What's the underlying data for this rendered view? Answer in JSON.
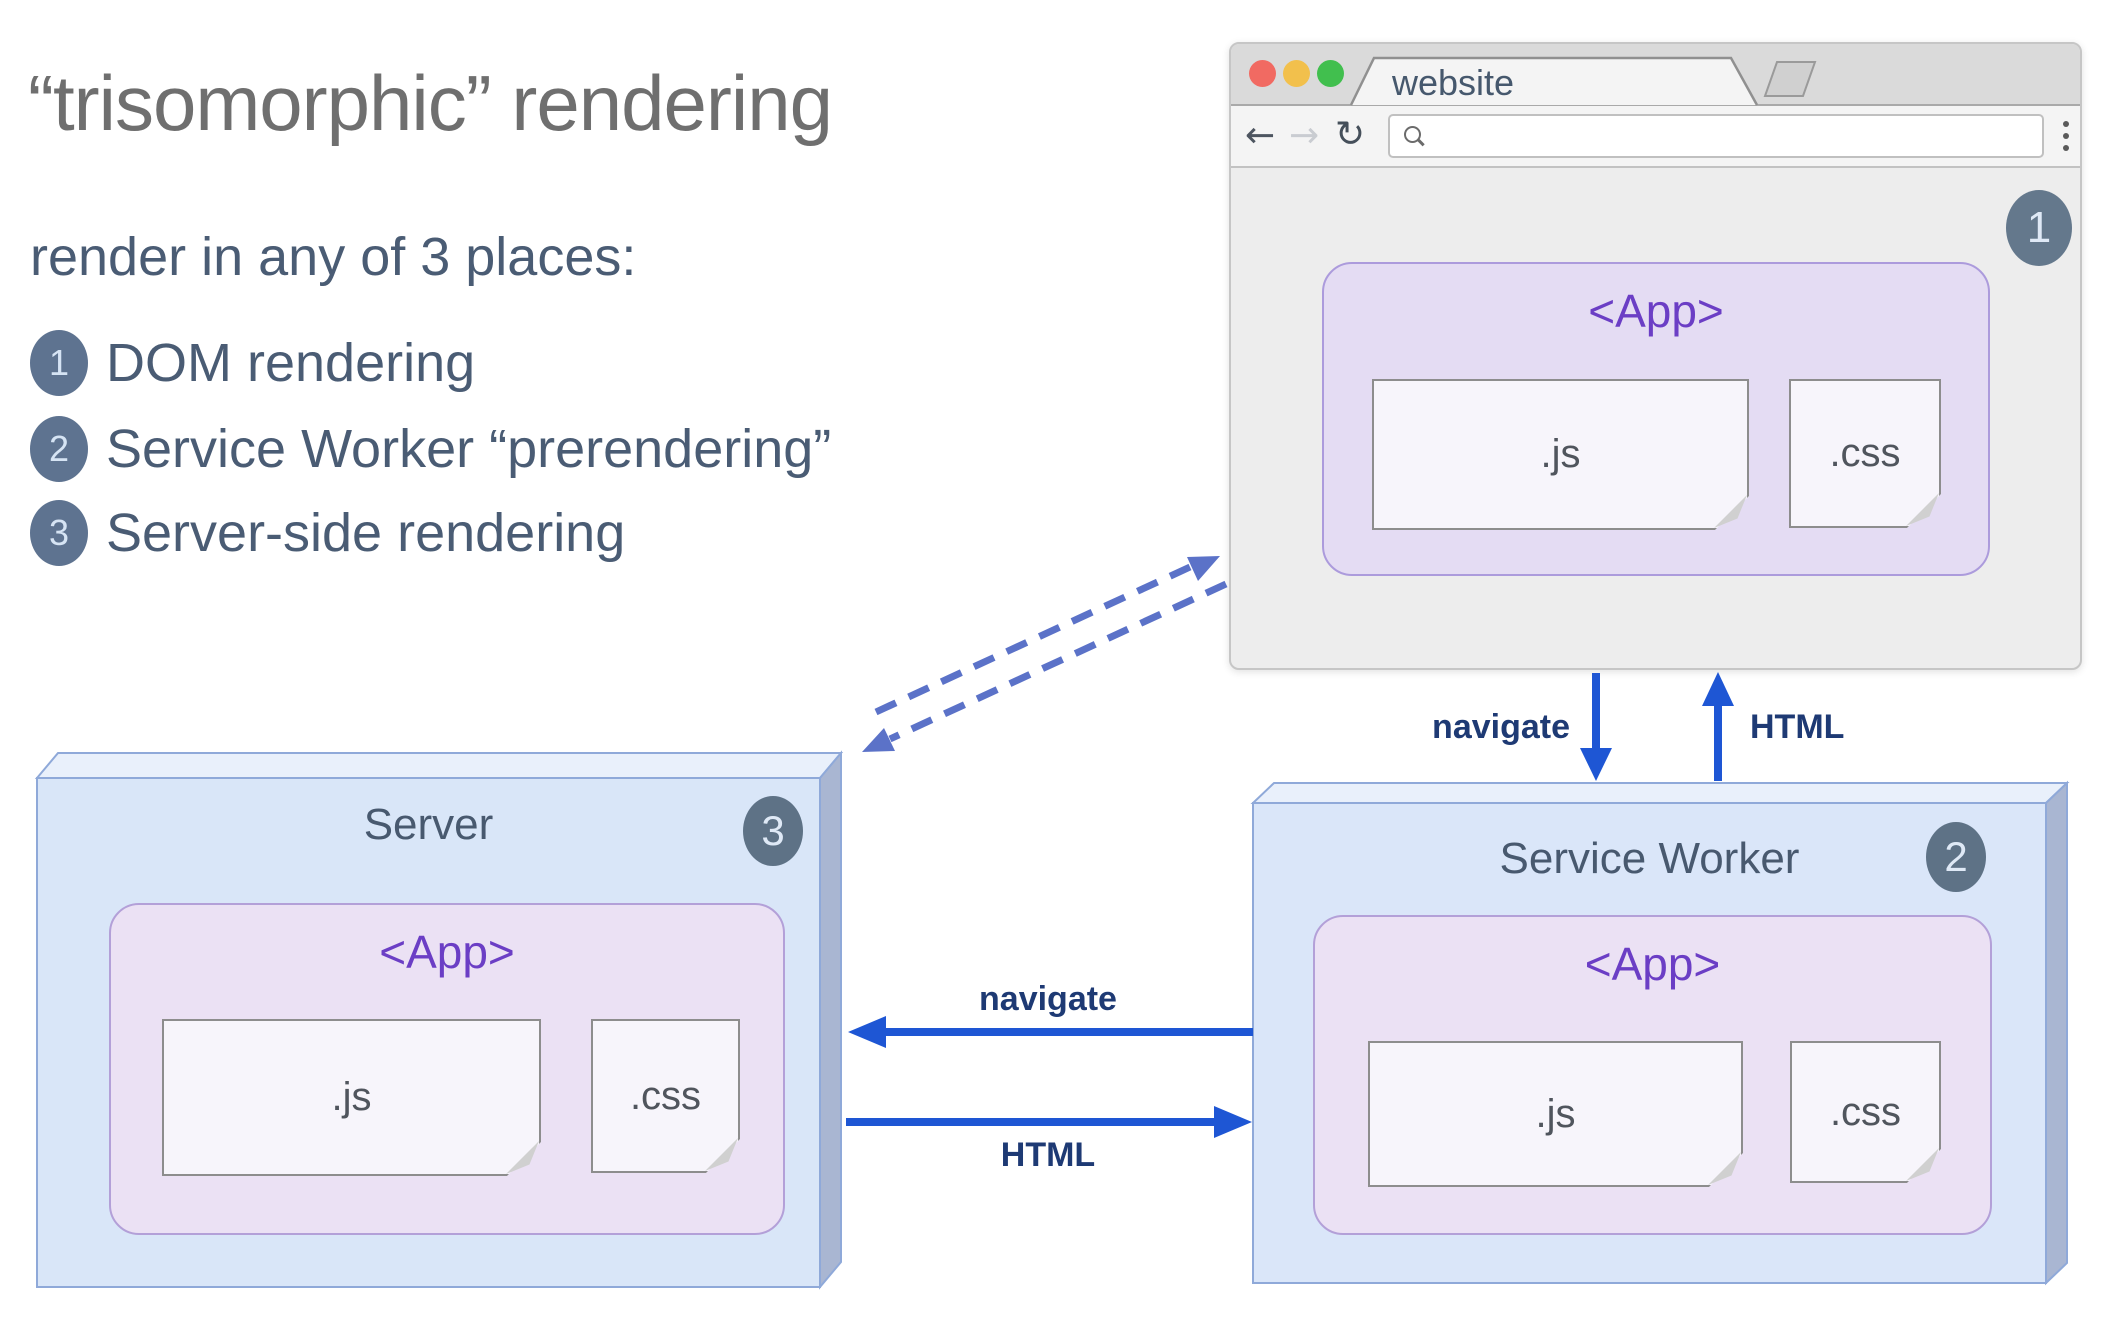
{
  "colors": {
    "accent_blue": "#1e56d4",
    "dashed_blue": "#5b72c8",
    "badge_slate": "#5e7390",
    "text_slate": "#4a5c74",
    "title_gray": "#6f6f6f",
    "app_purple": "#6b3ec5",
    "box_blue_front": "#d9e6f8",
    "traffic_red": "#f16a62",
    "traffic_yellow": "#f2c04c",
    "traffic_green": "#41bf4e"
  },
  "left_panel": {
    "title": "“trisomorphic” rendering",
    "subtitle": "render in any of 3 places:",
    "items": [
      {
        "num": "1",
        "label": "DOM rendering"
      },
      {
        "num": "2",
        "label": "Service Worker “prerendering”"
      },
      {
        "num": "3",
        "label": "Server-side rendering"
      }
    ]
  },
  "browser": {
    "tab_title": "website",
    "url_value": "",
    "badge": "1",
    "back_icon": "←",
    "forward_icon": "→",
    "reload_icon": "↻",
    "app": {
      "label": "<App>",
      "js": ".js",
      "css": ".css"
    }
  },
  "server_box": {
    "title": "Server",
    "badge": "3",
    "app": {
      "label": "<App>",
      "js": ".js",
      "css": ".css"
    }
  },
  "service_worker_box": {
    "title": "Service Worker",
    "badge": "2",
    "app": {
      "label": "<App>",
      "js": ".js",
      "css": ".css"
    }
  },
  "arrows": {
    "navigate_browser_to_sw": "navigate",
    "html_sw_to_browser": "HTML",
    "navigate_sw_to_server": "navigate",
    "html_server_to_sw": "HTML"
  }
}
